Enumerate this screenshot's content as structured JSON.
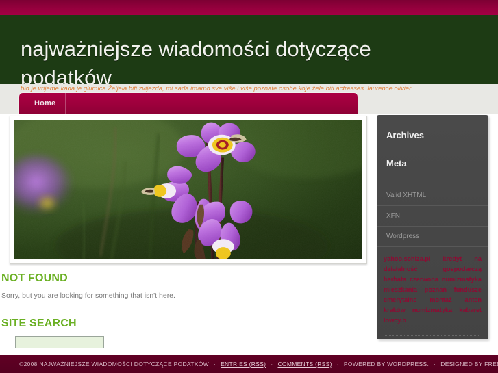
{
  "site": {
    "title": "najważniejsze wiadomości dotyczące podatków",
    "tagline": "bio je vrijeme kada je glumica Željela biti zvijezda, mi sada imamo sve više i više poznate osobe koje žele biti actresses. laurence olivier"
  },
  "nav": {
    "items": [
      {
        "label": "Home"
      }
    ]
  },
  "hero": {
    "alt": "shooting star wildflower photo"
  },
  "main": {
    "not_found_title": "NOT FOUND",
    "not_found_text": "Sorry, but you are looking for something that isn't here.",
    "site_search_title": "SITE SEARCH",
    "search_value": "",
    "search_placeholder": ""
  },
  "sidebar": {
    "archives_title": "Archives",
    "meta_title": "Meta",
    "meta_items": [
      {
        "label": "Valid XHTML"
      },
      {
        "label": "XFN"
      },
      {
        "label": "Wordpress"
      }
    ],
    "link_cloud": "yahoo.schiza.pl kredyt na działalność gospodarczą herbata czerwona numizmatyka mieszkania poznań fundusze emerytalne montaż anten kraków numizmatyka kabaret lowcy.b"
  },
  "footer": {
    "copyright": "©2008 NAJWAŻNIEJSZE WIADOMOŚCI DOTYCZĄCE PODATKÓW",
    "sep1": "·",
    "entries_rss": "ENTRIES (RSS)",
    "sep2": "·",
    "comments_rss": "COMMENTS (RSS)",
    "sep3": "·",
    "powered_by": "POWERED BY WORDPRESS.",
    "sep4": "·",
    "designed_by": "DESIGNED BY FREE WORDPRESS THEMES."
  },
  "colors": {
    "top_strip": "#8c0039",
    "header_green": "#1d3b14",
    "nav_maroon": "#a3003f",
    "accent_green": "#6ab023",
    "sidebar_dark": "#464646",
    "footer_maroon": "#5c0022",
    "tagline_orange": "#e0823f",
    "cloud_link": "#8c0c33"
  }
}
